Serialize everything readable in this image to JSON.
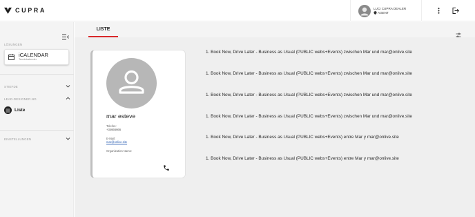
{
  "brand": {
    "logo_text": "CUPRA"
  },
  "user": {
    "name": "LUCI CUPRA DEALER",
    "role": "AGENT"
  },
  "sidebar": {
    "section_solutions": "LÖSUNGEN",
    "ical": {
      "title": "iCALENDAR",
      "subtitle": "Terminkalender"
    },
    "section_stammdaten": "STIEFDE",
    "section_leads": "LEAD-DESIGNER.NG",
    "liste_label": "Liste",
    "section_settings": "EINSTELLUNGEN"
  },
  "tabs": [
    {
      "label": "LISTE"
    }
  ],
  "contact": {
    "name": "mar esteve",
    "phone_label": "Telefon:",
    "phone_value": "+34666666",
    "email_label": "E-Mail:",
    "email_value": "mar@onlive.site",
    "org_label": "Organization Name:"
  },
  "events": [
    "1. Book Now, Drive Later - Business as Usual (PUBLIC webs+Events) zwischen Mar und mar@onlive.site",
    "1. Book Now, Drive Later - Business as Usual (PUBLIC webs+Events) zwischen Mar und mar@onlive.site",
    "1. Book Now, Drive Later - Business as Usual (PUBLIC webs+Events) zwischen Mar und mar@onlive.site",
    "1. Book Now, Drive Later - Business as Usual (PUBLIC webs+Events) zwischen Mar und mar@onlive.site",
    "1. Book Now, Drive Later - Business as Usual (PUBLIC webs+Events) entre Mar y mar@onlive.site",
    "1. Book Now, Drive Later - Business as Usual (PUBLIC webs+Events) entre Mar y mar@onlive.site"
  ],
  "colors": {
    "accent": "#d9282a",
    "link": "#2b5fb3"
  },
  "icons": [
    "cupra-logo-icon",
    "more-vert-icon",
    "logout-icon",
    "menu-collapse-icon",
    "calendar-icon",
    "chevron-down-icon",
    "chevron-up-icon",
    "list-icon",
    "filter-icon",
    "person-icon",
    "phone-icon"
  ]
}
